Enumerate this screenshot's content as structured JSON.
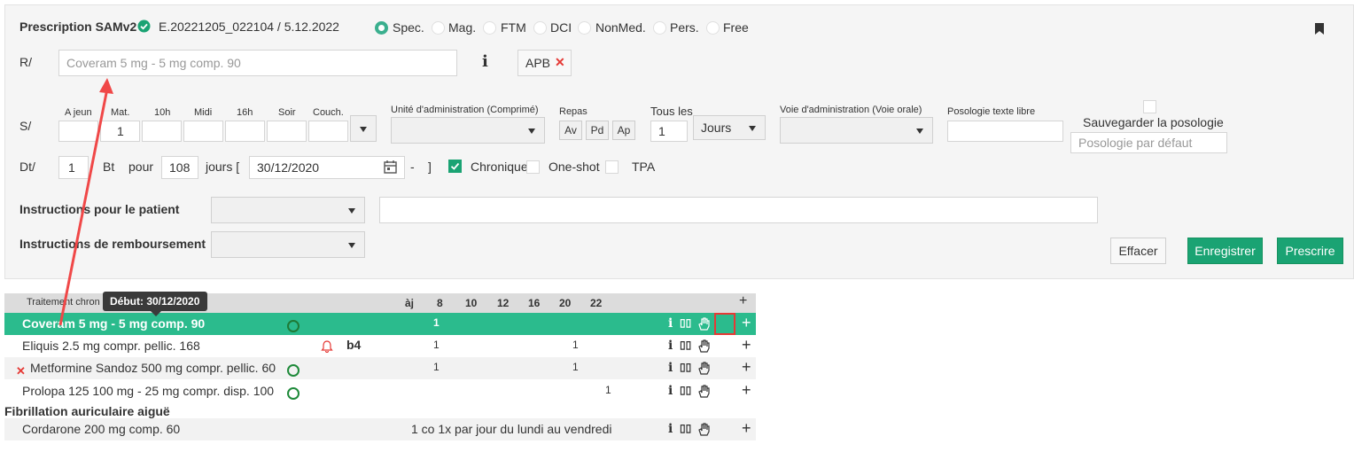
{
  "header": {
    "title": "Prescription SAMv2",
    "id": "E.20221205_022104 / 5.12.2022",
    "modes": [
      {
        "label": "Spec.",
        "selected": true
      },
      {
        "label": "Mag.",
        "selected": false
      },
      {
        "label": "FTM",
        "selected": false
      },
      {
        "label": "DCI",
        "selected": false
      },
      {
        "label": "NonMed.",
        "selected": false
      },
      {
        "label": "Pers.",
        "selected": false
      },
      {
        "label": "Free",
        "selected": false
      }
    ]
  },
  "r": {
    "label": "R/",
    "placeholder": "Coveram 5 mg - 5 mg comp. 90",
    "info": "i",
    "apb": "APB",
    "remove": "✕"
  },
  "s": {
    "label": "S/",
    "columns": [
      "A jeun",
      "Mat.",
      "10h",
      "Midi",
      "16h",
      "Soir",
      "Couch."
    ],
    "values": [
      "",
      "1",
      "",
      "",
      "",
      "",
      ""
    ],
    "unit_label": "Unité d'administration (Comprimé)",
    "repas_label": "Repas",
    "repas": [
      "Av",
      "Pd",
      "Ap"
    ],
    "tous_label": "Tous les",
    "tous_value": "1",
    "period": "Jours",
    "voie_label": "Voie d'administration (Voie orale)",
    "posologie_label": "Posologie texte libre",
    "save_label": "Sauvegarder la posologie",
    "default_placeholder": "Posologie par défaut"
  },
  "dt": {
    "label": "Dt/",
    "qty": "1",
    "bt": "Bt",
    "pour": "pour",
    "days": "108",
    "jours": "jours [",
    "date": "30/12/2020",
    "dash": "-",
    "bracket": "]",
    "chronique": "Chronique",
    "oneshot": "One-shot",
    "tpa": "TPA"
  },
  "instr": {
    "patient": "Instructions pour le patient",
    "remboursement": "Instructions de remboursement"
  },
  "buttons": {
    "effacer": "Effacer",
    "enregistrer": "Enregistrer",
    "prescrire": "Prescrire"
  },
  "table": {
    "title": "Traitement chron",
    "tooltip": "Début: 30/12/2020",
    "cols": [
      "àj",
      "8",
      "10",
      "12",
      "16",
      "20",
      "22"
    ],
    "rows": [
      {
        "name": "Coveram 5 mg - 5 mg comp. 90",
        "v8": "1",
        "v20": "",
        "v22": "",
        "flag": "",
        "note": ""
      },
      {
        "name": "Eliquis 2.5 mg compr. pellic. 168",
        "v8": "1",
        "v20": "1",
        "v22": "",
        "flag": "b4",
        "note": ""
      },
      {
        "name": "Metformine Sandoz 500 mg compr. pellic. 60",
        "v8": "1",
        "v20": "1",
        "v22": "",
        "flag": "",
        "note": ""
      },
      {
        "name": "Prolopa 125 100 mg - 25 mg compr. disp. 100",
        "v8": "",
        "v20": "",
        "v22": "1",
        "flag": "",
        "note": ""
      }
    ],
    "section": "Fibrillation auriculaire aiguë",
    "section_row": {
      "name": "Cordarone 200 mg comp. 60",
      "note": "1 co 1x par jour du lundi au vendredi"
    },
    "icons": {
      "info": "i",
      "columns": "▯▯",
      "plus": "+"
    }
  },
  "colors": {
    "green": "#1aa373",
    "selected_row": "#2bbb8d",
    "arrow": "#f04848"
  }
}
